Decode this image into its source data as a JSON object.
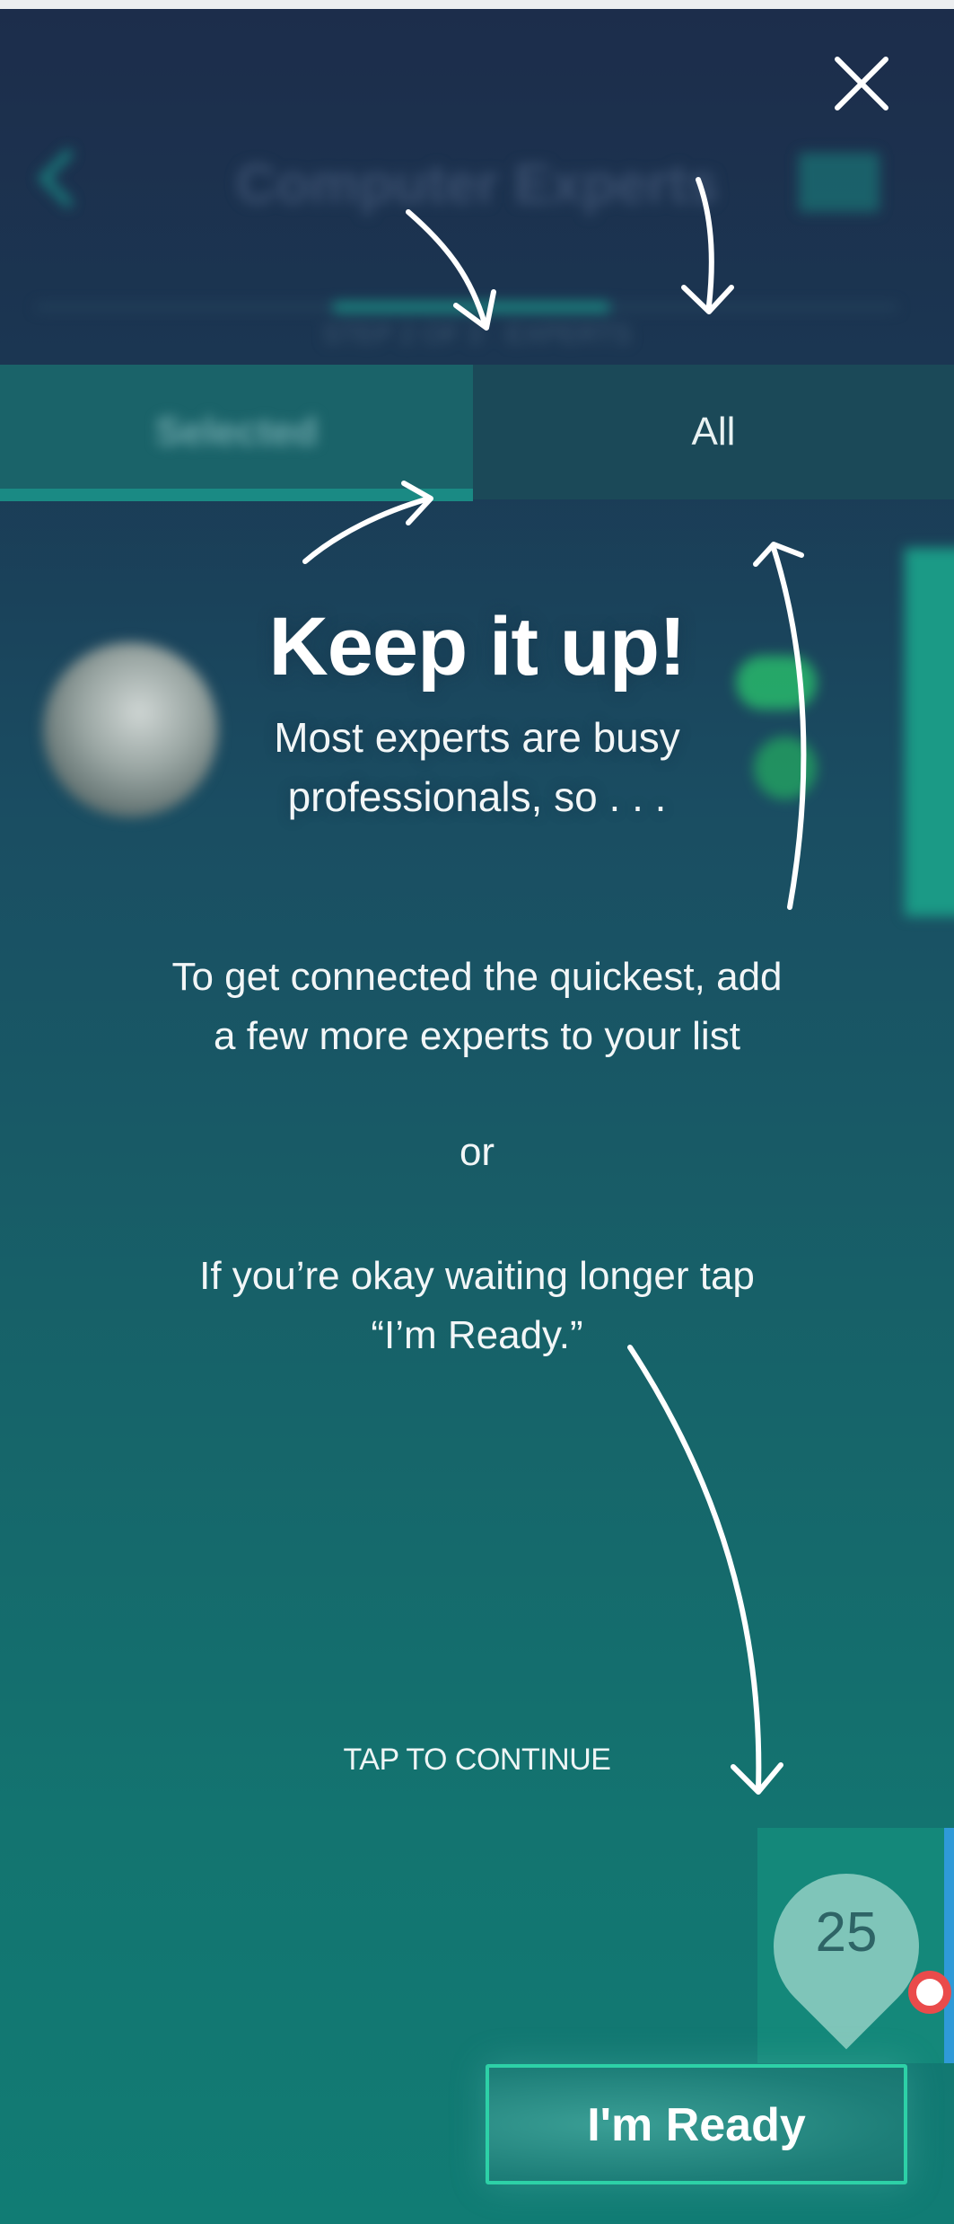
{
  "background_app": {
    "title": "Computer Experts",
    "subtitle": "STEP 2 OF 3 · EXPERTS",
    "tabs": [
      {
        "label": "Selected"
      },
      {
        "label": "All"
      }
    ]
  },
  "overlay": {
    "headline": "Keep it up!",
    "subline_1": "Most experts are busy",
    "subline_2": "professionals, so . . .",
    "body_1_line_1": "To get connected the quickest, add",
    "body_1_line_2": "a few more experts to your list",
    "or": "or",
    "body_2_line_1": "If you’re okay waiting longer tap",
    "body_2_line_2": "“I’m Ready.”",
    "tap_to_continue": "TAP TO CONTINUE"
  },
  "badge": {
    "count": "25"
  },
  "ready_button": {
    "label": "I'm Ready"
  },
  "colors": {
    "accent": "#2dd1a7",
    "badge": "#7fc5b9",
    "status_dot": "#ea4b4b"
  },
  "icons": {
    "close": "close-icon",
    "back": "chevron-left-icon",
    "menu": "menu-icon",
    "arrows": "hand-drawn-arrow-icon"
  }
}
